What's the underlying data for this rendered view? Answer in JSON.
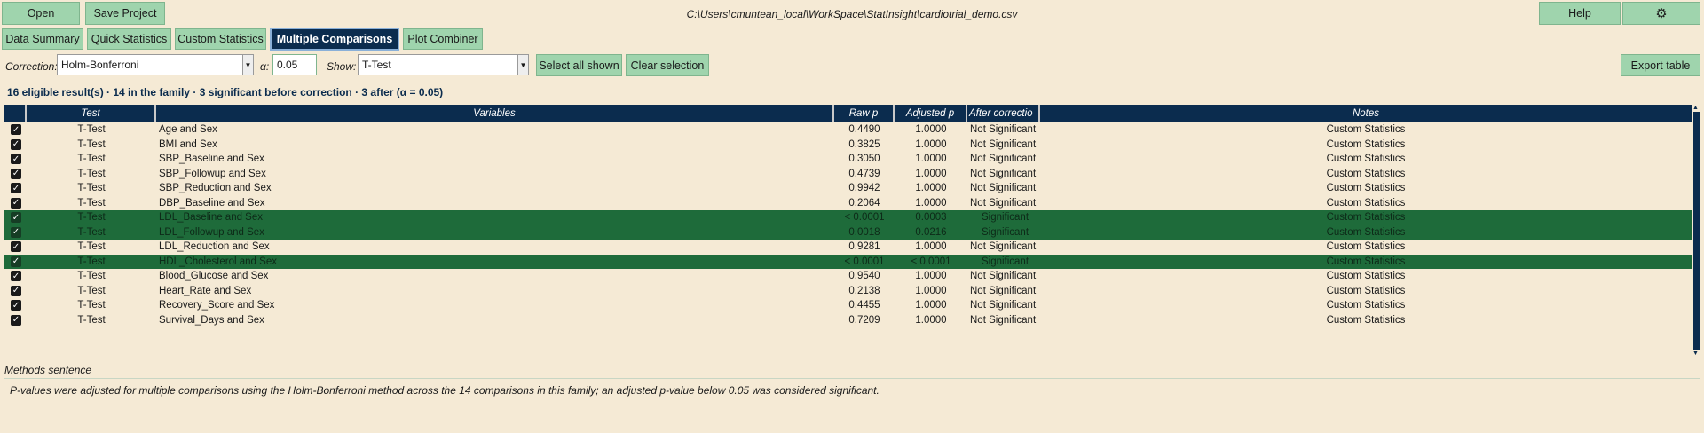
{
  "toolbar": {
    "open_label": "Open",
    "save_label": "Save Project",
    "file_path": "C:\\Users\\cmuntean_local\\WorkSpace\\StatInsight\\cardiotrial_demo.csv",
    "help_label": "Help",
    "settings_icon": "⚙"
  },
  "tabs": [
    {
      "label": "Data Summary"
    },
    {
      "label": "Quick Statistics"
    },
    {
      "label": "Custom Statistics"
    },
    {
      "label": "Multiple Comparisons"
    },
    {
      "label": "Plot Combiner"
    }
  ],
  "controls": {
    "correction_label": "Correction:",
    "correction_value": "Holm-Bonferroni",
    "alpha_label": "α:",
    "alpha_value": "0.05",
    "show_label": "Show:",
    "show_value": "T-Test",
    "select_all_label": "Select all shown",
    "clear_label": "Clear selection",
    "export_label": "Export table"
  },
  "summary": "16 eligible result(s) · 14 in the family · 3 significant before correction · 3 after (α = 0.05)",
  "columns": [
    "Test",
    "Variables",
    "Raw p",
    "Adjusted p",
    "After correctio",
    "Notes"
  ],
  "rows": [
    {
      "test": "T-Test",
      "vars": "Age and Sex",
      "raw": "0.4490",
      "adj": "1.0000",
      "after": "Not Significant",
      "notes": "Custom Statistics",
      "sig": false
    },
    {
      "test": "T-Test",
      "vars": "BMI and Sex",
      "raw": "0.3825",
      "adj": "1.0000",
      "after": "Not Significant",
      "notes": "Custom Statistics",
      "sig": false
    },
    {
      "test": "T-Test",
      "vars": "SBP_Baseline and Sex",
      "raw": "0.3050",
      "adj": "1.0000",
      "after": "Not Significant",
      "notes": "Custom Statistics",
      "sig": false
    },
    {
      "test": "T-Test",
      "vars": "SBP_Followup and Sex",
      "raw": "0.4739",
      "adj": "1.0000",
      "after": "Not Significant",
      "notes": "Custom Statistics",
      "sig": false
    },
    {
      "test": "T-Test",
      "vars": "SBP_Reduction and Sex",
      "raw": "0.9942",
      "adj": "1.0000",
      "after": "Not Significant",
      "notes": "Custom Statistics",
      "sig": false
    },
    {
      "test": "T-Test",
      "vars": "DBP_Baseline and Sex",
      "raw": "0.2064",
      "adj": "1.0000",
      "after": "Not Significant",
      "notes": "Custom Statistics",
      "sig": false
    },
    {
      "test": "T-Test",
      "vars": "LDL_Baseline and Sex",
      "raw": "< 0.0001",
      "adj": "0.0003",
      "after": "Significant",
      "notes": "Custom Statistics",
      "sig": true
    },
    {
      "test": "T-Test",
      "vars": "LDL_Followup and Sex",
      "raw": "0.0018",
      "adj": "0.0216",
      "after": "Significant",
      "notes": "Custom Statistics",
      "sig": true
    },
    {
      "test": "T-Test",
      "vars": "LDL_Reduction and Sex",
      "raw": "0.9281",
      "adj": "1.0000",
      "after": "Not Significant",
      "notes": "Custom Statistics",
      "sig": false
    },
    {
      "test": "T-Test",
      "vars": "HDL_Cholesterol and Sex",
      "raw": "< 0.0001",
      "adj": "< 0.0001",
      "after": "Significant",
      "notes": "Custom Statistics",
      "sig": true
    },
    {
      "test": "T-Test",
      "vars": "Blood_Glucose and Sex",
      "raw": "0.9540",
      "adj": "1.0000",
      "after": "Not Significant",
      "notes": "Custom Statistics",
      "sig": false
    },
    {
      "test": "T-Test",
      "vars": "Heart_Rate and Sex",
      "raw": "0.2138",
      "adj": "1.0000",
      "after": "Not Significant",
      "notes": "Custom Statistics",
      "sig": false
    },
    {
      "test": "T-Test",
      "vars": "Recovery_Score and Sex",
      "raw": "0.4455",
      "adj": "1.0000",
      "after": "Not Significant",
      "notes": "Custom Statistics",
      "sig": false
    },
    {
      "test": "T-Test",
      "vars": "Survival_Days and Sex",
      "raw": "0.7209",
      "adj": "1.0000",
      "after": "Not Significant",
      "notes": "Custom Statistics",
      "sig": false
    }
  ],
  "methods": {
    "label": "Methods sentence",
    "text": "P-values were adjusted for multiple comparisons using the Holm-Bonferroni method across the 14 comparisons in this family; an adjusted p-value below 0.05 was considered significant."
  }
}
